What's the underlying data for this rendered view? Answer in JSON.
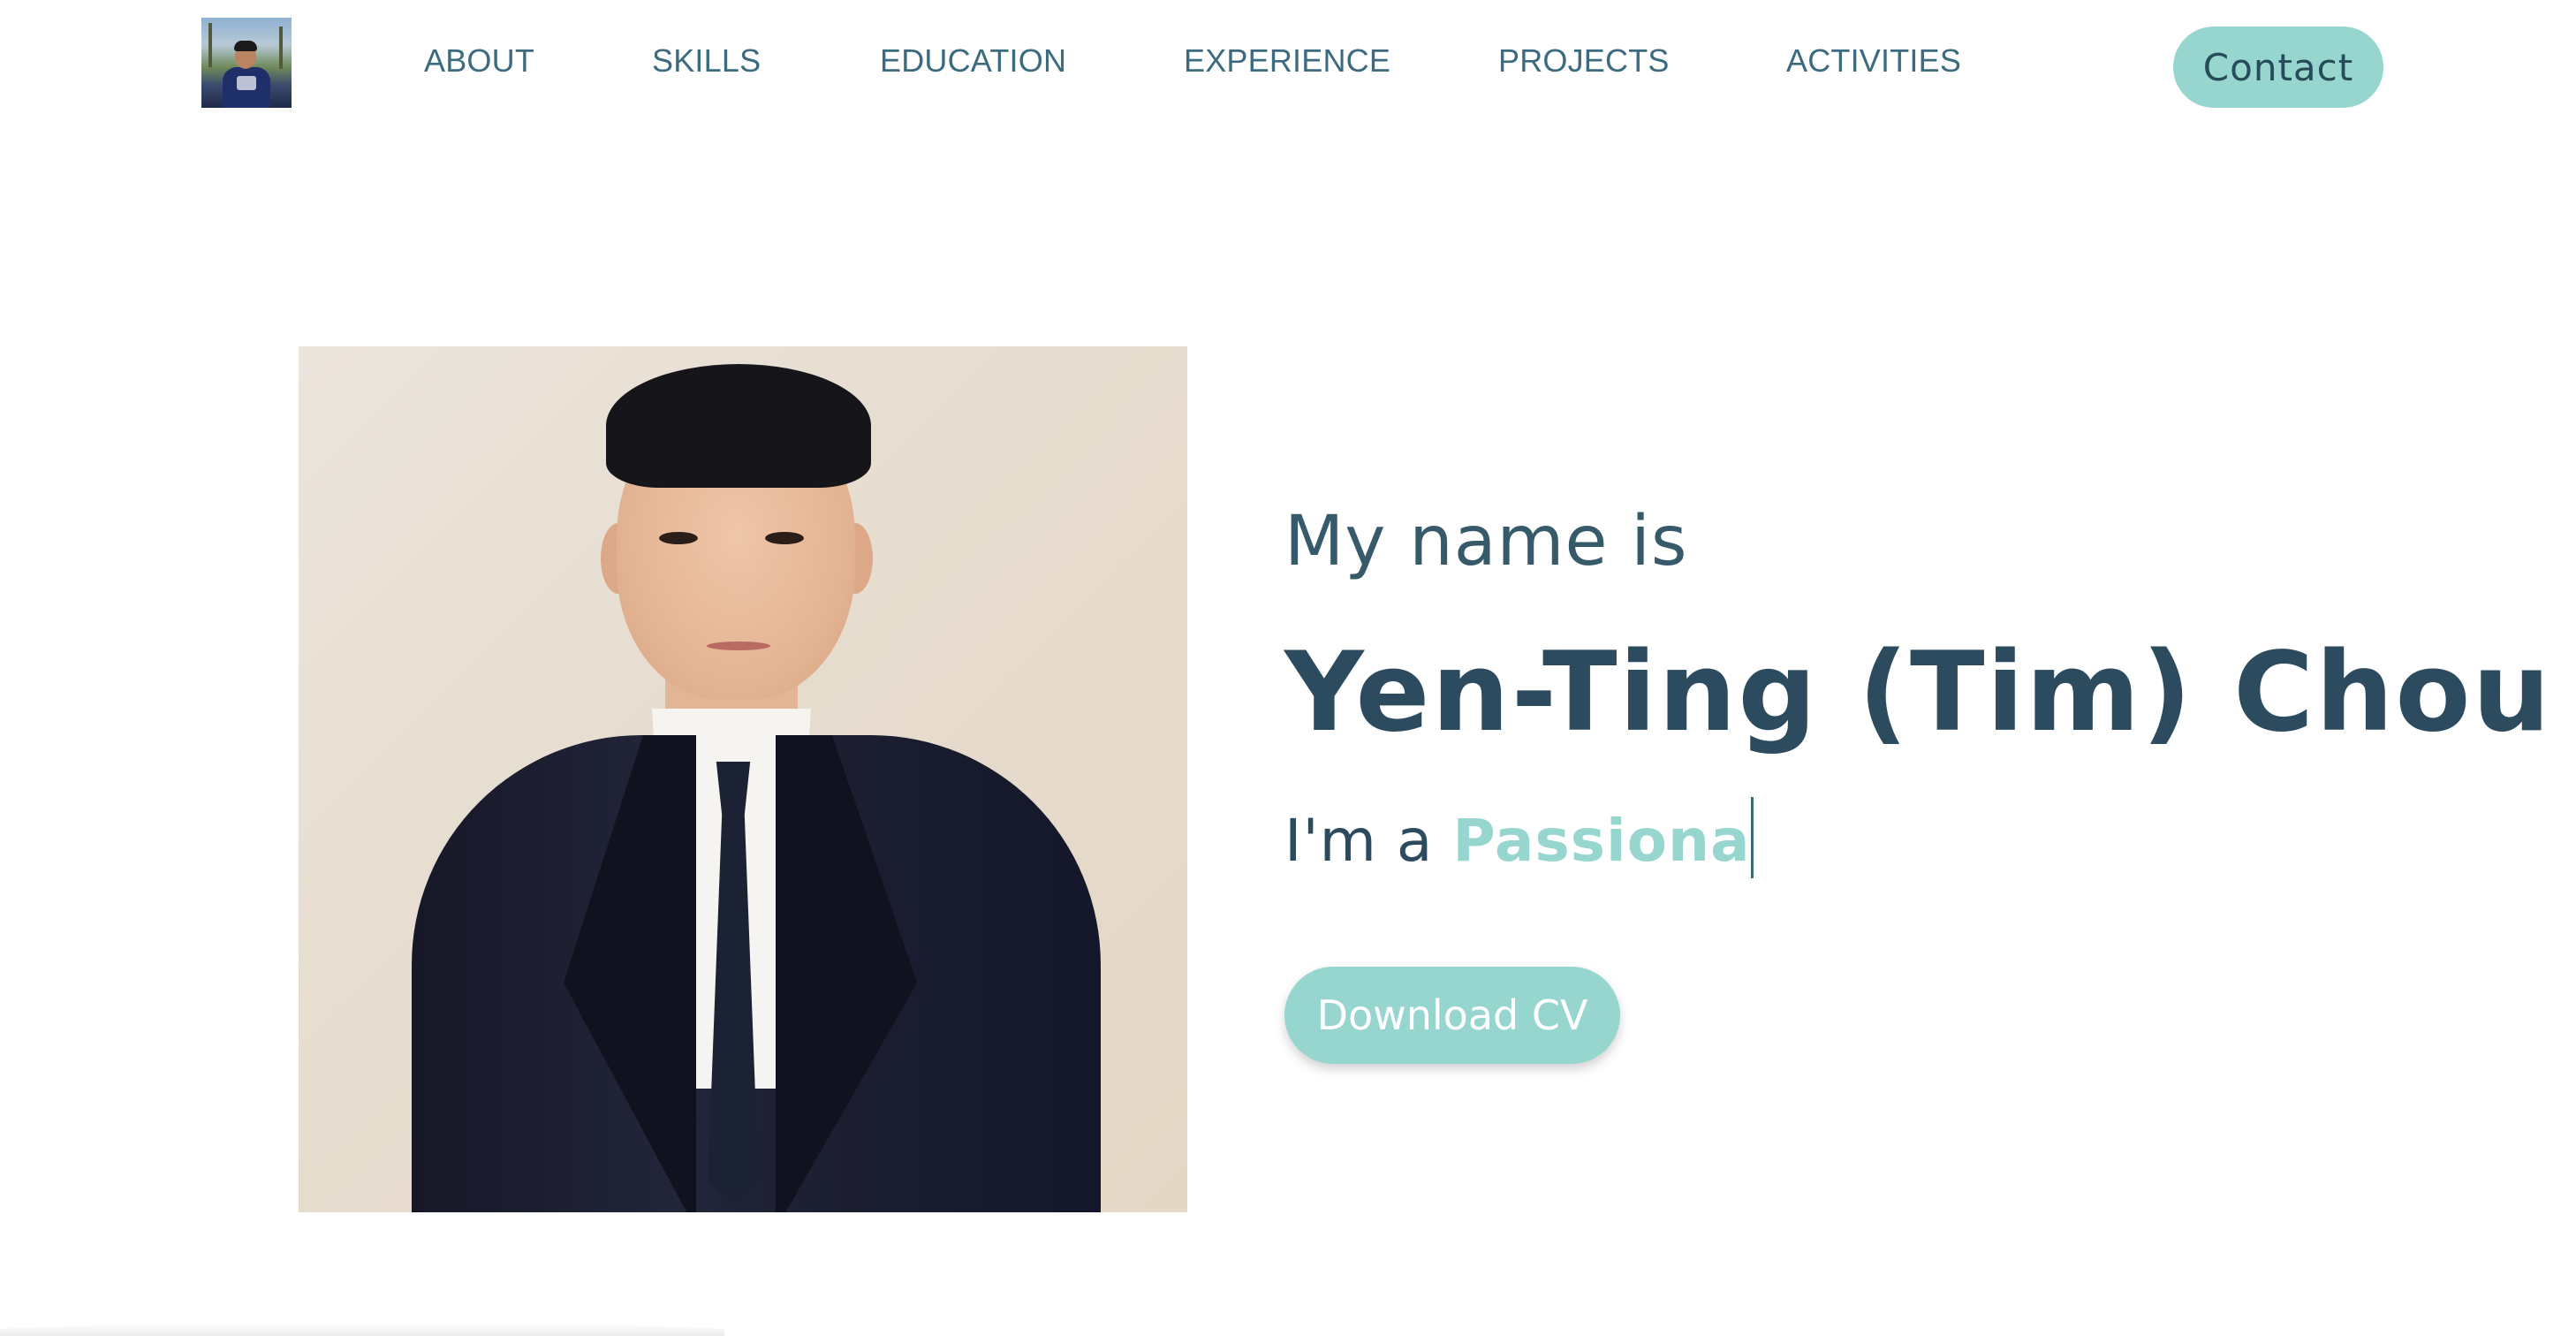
{
  "header": {
    "nav": [
      {
        "label": "ABOUT"
      },
      {
        "label": "SKILLS"
      },
      {
        "label": "EDUCATION"
      },
      {
        "label": "EXPERIENCE"
      },
      {
        "label": "PROJECTS"
      },
      {
        "label": "ACTIVITIES"
      }
    ],
    "contact_label": "Contact"
  },
  "hero": {
    "intro_prefix": "My name is",
    "name": "Yen-Ting (Tim) Chou",
    "role_prefix": "I'm a ",
    "role_typed": "Passiona",
    "download_label": "Download CV"
  },
  "colors": {
    "accent": "#96d6cf",
    "nav_text": "#3c6a7e",
    "heading_text": "#2c4b5e"
  }
}
